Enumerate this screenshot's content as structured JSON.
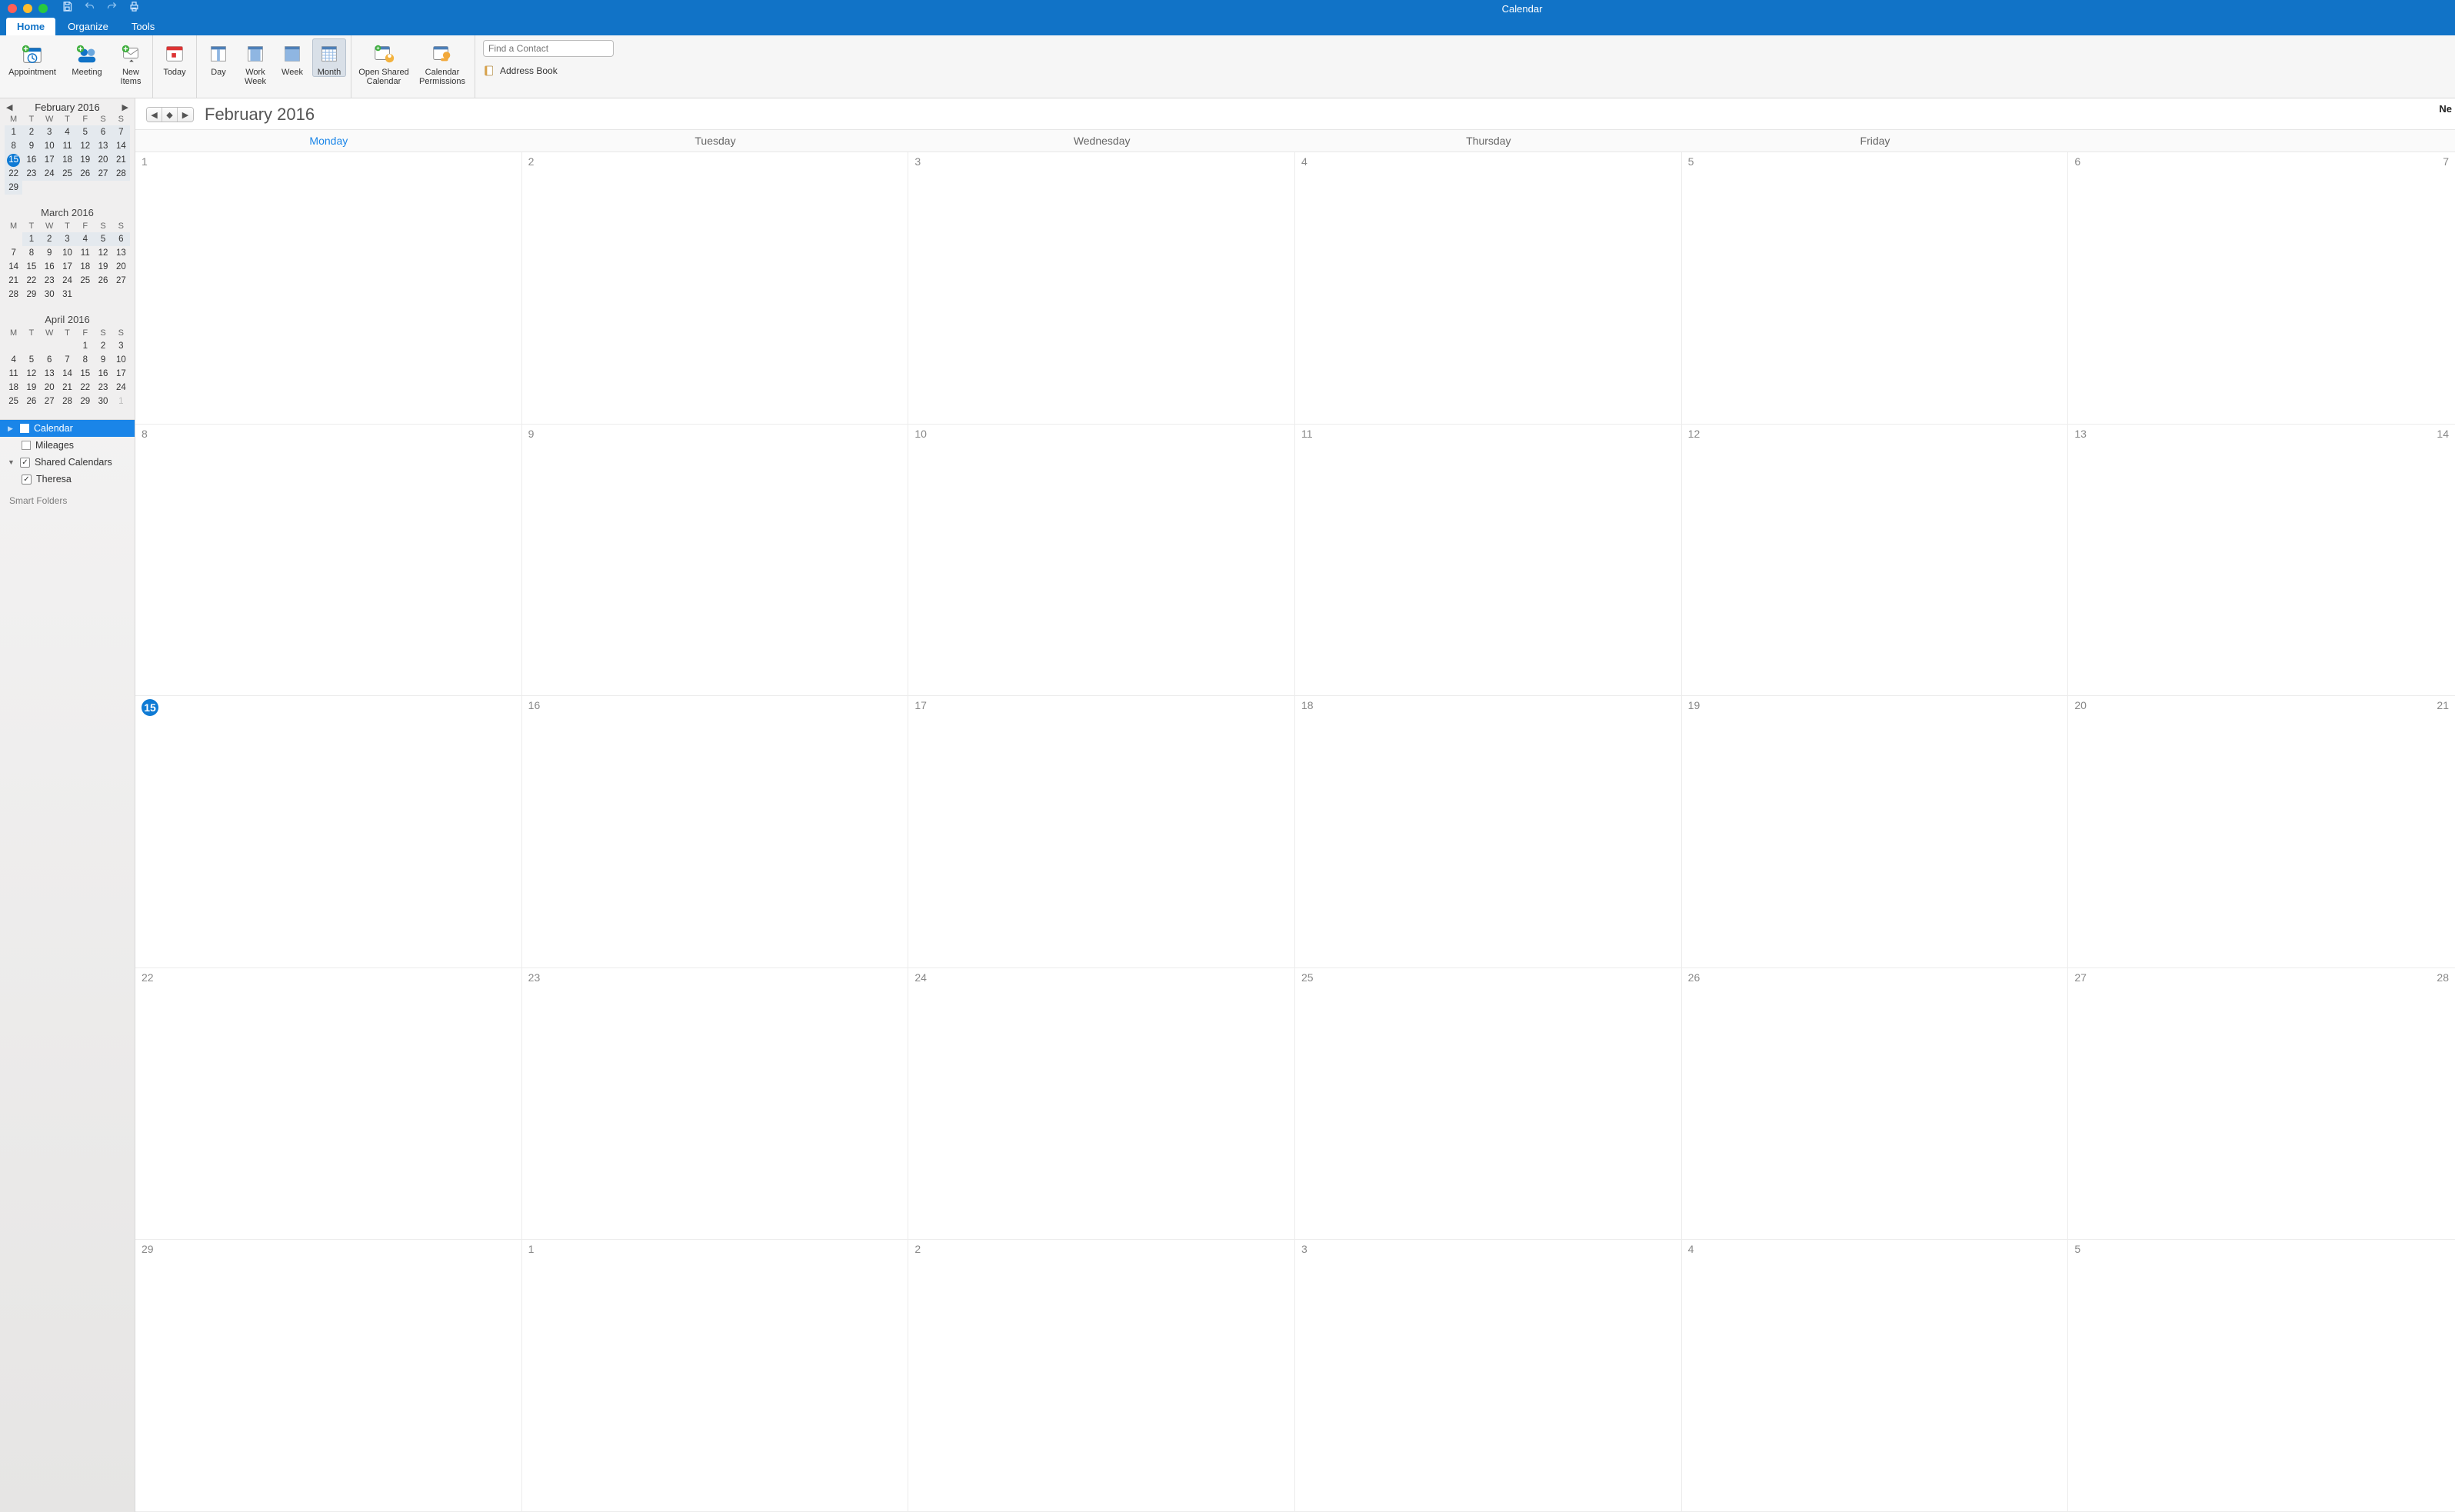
{
  "window_title": "Calendar",
  "tabs": {
    "home": "Home",
    "organize": "Organize",
    "tools": "Tools"
  },
  "ribbon": {
    "appointment": "Appointment",
    "meeting": "Meeting",
    "new_items": "New\nItems",
    "today": "Today",
    "day": "Day",
    "work_week": "Work\nWeek",
    "week": "Week",
    "month": "Month",
    "open_shared": "Open Shared\nCalendar",
    "permissions": "Calendar\nPermissions",
    "find_contact_placeholder": "Find a Contact",
    "address_book": "Address Book"
  },
  "nav": {
    "title": "February 2016",
    "dow": [
      "M",
      "T",
      "W",
      "T",
      "F",
      "S",
      "S"
    ],
    "months": [
      {
        "title": "February 2016",
        "weeks": [
          [
            {
              "d": "1",
              "s": true
            },
            {
              "d": "2",
              "s": true
            },
            {
              "d": "3",
              "s": true
            },
            {
              "d": "4",
              "s": true
            },
            {
              "d": "5",
              "s": true
            },
            {
              "d": "6",
              "s": true
            },
            {
              "d": "7",
              "s": true
            }
          ],
          [
            {
              "d": "8",
              "s": true
            },
            {
              "d": "9",
              "s": true
            },
            {
              "d": "10",
              "s": true
            },
            {
              "d": "11",
              "s": true
            },
            {
              "d": "12",
              "s": true
            },
            {
              "d": "13",
              "s": true
            },
            {
              "d": "14",
              "s": true
            }
          ],
          [
            {
              "d": "15",
              "s": true,
              "today": true
            },
            {
              "d": "16",
              "s": true
            },
            {
              "d": "17",
              "s": true
            },
            {
              "d": "18",
              "s": true
            },
            {
              "d": "19",
              "s": true
            },
            {
              "d": "20",
              "s": true
            },
            {
              "d": "21",
              "s": true
            }
          ],
          [
            {
              "d": "22",
              "s": true
            },
            {
              "d": "23",
              "s": true
            },
            {
              "d": "24",
              "s": true
            },
            {
              "d": "25",
              "s": true
            },
            {
              "d": "26",
              "s": true
            },
            {
              "d": "27",
              "s": true
            },
            {
              "d": "28",
              "s": true
            }
          ],
          [
            {
              "d": "29",
              "s": true
            },
            {
              "d": ""
            },
            {
              "d": ""
            },
            {
              "d": ""
            },
            {
              "d": ""
            },
            {
              "d": ""
            },
            {
              "d": ""
            }
          ]
        ]
      },
      {
        "title": "March 2016",
        "weeks": [
          [
            {
              "d": ""
            },
            {
              "d": "1",
              "s": true
            },
            {
              "d": "2",
              "s": true
            },
            {
              "d": "3",
              "s": true
            },
            {
              "d": "4",
              "s": true
            },
            {
              "d": "5",
              "s": true
            },
            {
              "d": "6",
              "s": true
            }
          ],
          [
            {
              "d": "7"
            },
            {
              "d": "8"
            },
            {
              "d": "9"
            },
            {
              "d": "10"
            },
            {
              "d": "11"
            },
            {
              "d": "12"
            },
            {
              "d": "13"
            }
          ],
          [
            {
              "d": "14"
            },
            {
              "d": "15"
            },
            {
              "d": "16"
            },
            {
              "d": "17"
            },
            {
              "d": "18"
            },
            {
              "d": "19"
            },
            {
              "d": "20"
            }
          ],
          [
            {
              "d": "21"
            },
            {
              "d": "22"
            },
            {
              "d": "23"
            },
            {
              "d": "24"
            },
            {
              "d": "25"
            },
            {
              "d": "26"
            },
            {
              "d": "27"
            }
          ],
          [
            {
              "d": "28"
            },
            {
              "d": "29"
            },
            {
              "d": "30"
            },
            {
              "d": "31"
            },
            {
              "d": ""
            },
            {
              "d": ""
            },
            {
              "d": ""
            }
          ]
        ]
      },
      {
        "title": "April 2016",
        "weeks": [
          [
            {
              "d": ""
            },
            {
              "d": ""
            },
            {
              "d": ""
            },
            {
              "d": ""
            },
            {
              "d": "1"
            },
            {
              "d": "2"
            },
            {
              "d": "3"
            }
          ],
          [
            {
              "d": "4"
            },
            {
              "d": "5"
            },
            {
              "d": "6"
            },
            {
              "d": "7"
            },
            {
              "d": "8"
            },
            {
              "d": "9"
            },
            {
              "d": "10"
            }
          ],
          [
            {
              "d": "11"
            },
            {
              "d": "12"
            },
            {
              "d": "13"
            },
            {
              "d": "14"
            },
            {
              "d": "15"
            },
            {
              "d": "16"
            },
            {
              "d": "17"
            }
          ],
          [
            {
              "d": "18"
            },
            {
              "d": "19"
            },
            {
              "d": "20"
            },
            {
              "d": "21"
            },
            {
              "d": "22"
            },
            {
              "d": "23"
            },
            {
              "d": "24"
            }
          ],
          [
            {
              "d": "25"
            },
            {
              "d": "26"
            },
            {
              "d": "27"
            },
            {
              "d": "28"
            },
            {
              "d": "29"
            },
            {
              "d": "30"
            },
            {
              "d": "1",
              "dim": true
            }
          ]
        ]
      }
    ]
  },
  "calendars": {
    "calendar": "Calendar",
    "mileages": "Mileages",
    "shared": "Shared Calendars",
    "theresa": "Theresa",
    "smart": "Smart Folders"
  },
  "main": {
    "title": "February 2016",
    "corner": "Ne",
    "weekdays": [
      "Monday",
      "Tuesday",
      "Wednesday",
      "Thursday",
      "Friday"
    ],
    "current_col": 0,
    "cells": [
      {
        "n": "1"
      },
      {
        "n": "2"
      },
      {
        "n": "3"
      },
      {
        "n": "4"
      },
      {
        "n": "5"
      },
      {
        "wknd": [
          "6",
          "7"
        ]
      },
      {
        "n": "8"
      },
      {
        "n": "9"
      },
      {
        "n": "10"
      },
      {
        "n": "11"
      },
      {
        "n": "12"
      },
      {
        "wknd": [
          "13",
          "14"
        ]
      },
      {
        "n": "15",
        "today": true
      },
      {
        "n": "16"
      },
      {
        "n": "17"
      },
      {
        "n": "18"
      },
      {
        "n": "19"
      },
      {
        "wknd": [
          "20",
          "21"
        ]
      },
      {
        "n": "22"
      },
      {
        "n": "23"
      },
      {
        "n": "24"
      },
      {
        "n": "25"
      },
      {
        "n": "26"
      },
      {
        "wknd": [
          "27",
          "28"
        ]
      },
      {
        "n": "29"
      },
      {
        "n": "1"
      },
      {
        "n": "2"
      },
      {
        "n": "3"
      },
      {
        "n": "4"
      },
      {
        "wknd": [
          "5",
          ""
        ]
      }
    ]
  }
}
